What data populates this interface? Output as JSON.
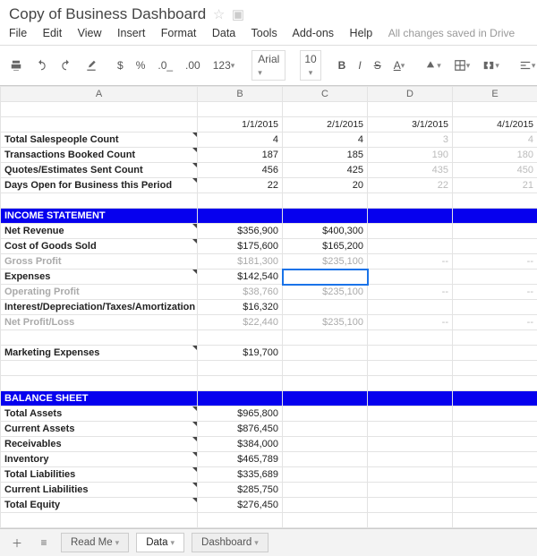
{
  "doc": {
    "title": "Copy of Business Dashboard",
    "save_status": "All changes saved in Drive"
  },
  "menus": [
    "File",
    "Edit",
    "View",
    "Insert",
    "Format",
    "Data",
    "Tools",
    "Add-ons",
    "Help"
  ],
  "toolbar": {
    "font": "Arial",
    "size": "10",
    "currency": "$",
    "percent": "%",
    "dec_dec": ".0_",
    "dec_inc": ".00",
    "numfmt": "123"
  },
  "columns": [
    "A",
    "B",
    "C",
    "D",
    "E"
  ],
  "dates": [
    "1/1/2015",
    "2/1/2015",
    "3/1/2015",
    "4/1/2015"
  ],
  "rows": [
    {
      "label": "Total Salespeople Count",
      "b": "4",
      "c": "4",
      "d": "3",
      "e": "4",
      "note": true
    },
    {
      "label": "Transactions Booked Count",
      "b": "187",
      "c": "185",
      "d": "190",
      "e": "180",
      "note": true
    },
    {
      "label": "Quotes/Estimates Sent Count",
      "b": "456",
      "c": "425",
      "d": "435",
      "e": "450",
      "note": true
    },
    {
      "label": "Days Open for Business this Period",
      "b": "22",
      "c": "20",
      "d": "22",
      "e": "21",
      "note": true
    }
  ],
  "section1": "INCOME STATEMENT",
  "income": [
    {
      "label": "Net Revenue",
      "b": "$356,900",
      "c": "$400,300",
      "note": true
    },
    {
      "label": "Cost of Goods Sold",
      "b": "$175,600",
      "c": "$165,200",
      "note": true
    },
    {
      "label": "Gross Profit",
      "b": "$181,300",
      "c": "$235,100",
      "d": "--",
      "e": "--",
      "gray": true
    },
    {
      "label": "Expenses",
      "b": "$142,540",
      "sel": true,
      "note": true
    },
    {
      "label": "Operating Profit",
      "b": "$38,760",
      "c": "$235,100",
      "d": "--",
      "e": "--",
      "gray": true
    },
    {
      "label": "Interest/Depreciation/Taxes/Amortization",
      "b": "$16,320"
    },
    {
      "label": "Net Profit/Loss",
      "b": "$22,440",
      "c": "$235,100",
      "d": "--",
      "e": "--",
      "gray": true
    }
  ],
  "marketing": {
    "label": "Marketing Expenses",
    "b": "$19,700",
    "note": true
  },
  "section2": "BALANCE SHEET",
  "balance": [
    {
      "label": "Total Assets",
      "b": "$965,800",
      "note": true
    },
    {
      "label": "Current Assets",
      "b": "$876,450",
      "note": true
    },
    {
      "label": "Receivables",
      "b": "$384,000",
      "note": true
    },
    {
      "label": "Inventory",
      "b": "$465,789",
      "note": true
    },
    {
      "label": "Total Liabilities",
      "b": "$335,689",
      "note": true
    },
    {
      "label": "Current Liabilities",
      "b": "$285,750",
      "note": true
    },
    {
      "label": "Total Equity",
      "b": "$276,450",
      "note": true
    }
  ],
  "tabs": [
    "Read Me",
    "Data",
    "Dashboard"
  ],
  "active_tab": "Data"
}
